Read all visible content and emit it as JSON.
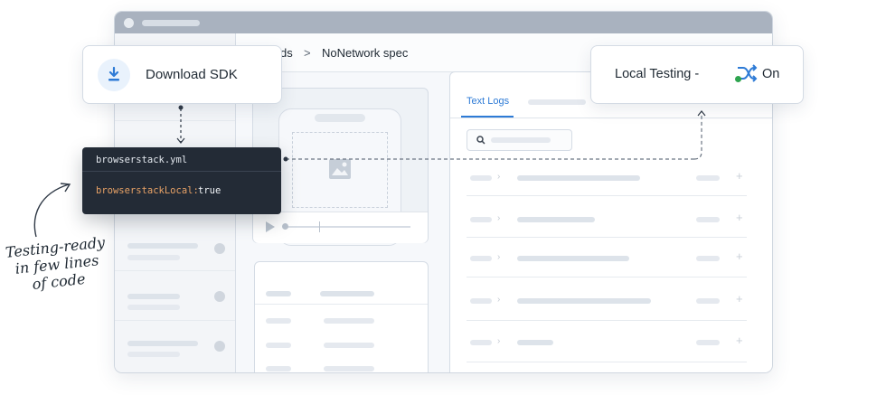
{
  "breadcrumb": {
    "prev": "ds",
    "separator": ">",
    "current": "NoNetwork spec"
  },
  "download_card": {
    "label": "Download SDK",
    "icon": "download-icon"
  },
  "local_testing_card": {
    "label": "Local Testing -",
    "state": "On",
    "icon": "shuffle-icon",
    "status_color": "#2ea44f"
  },
  "logs_panel": {
    "tab_label": "Text Logs"
  },
  "code_snippet": {
    "filename": "browserstack.yml",
    "key": "browserstackLocal:",
    "value": "true"
  },
  "annotation": {
    "line1": "Testing-ready",
    "line2": "in few lines",
    "line3": "of code"
  },
  "colors": {
    "accent": "#2e7bd6",
    "code_bg": "#232b36",
    "code_key": "#e8a266"
  }
}
